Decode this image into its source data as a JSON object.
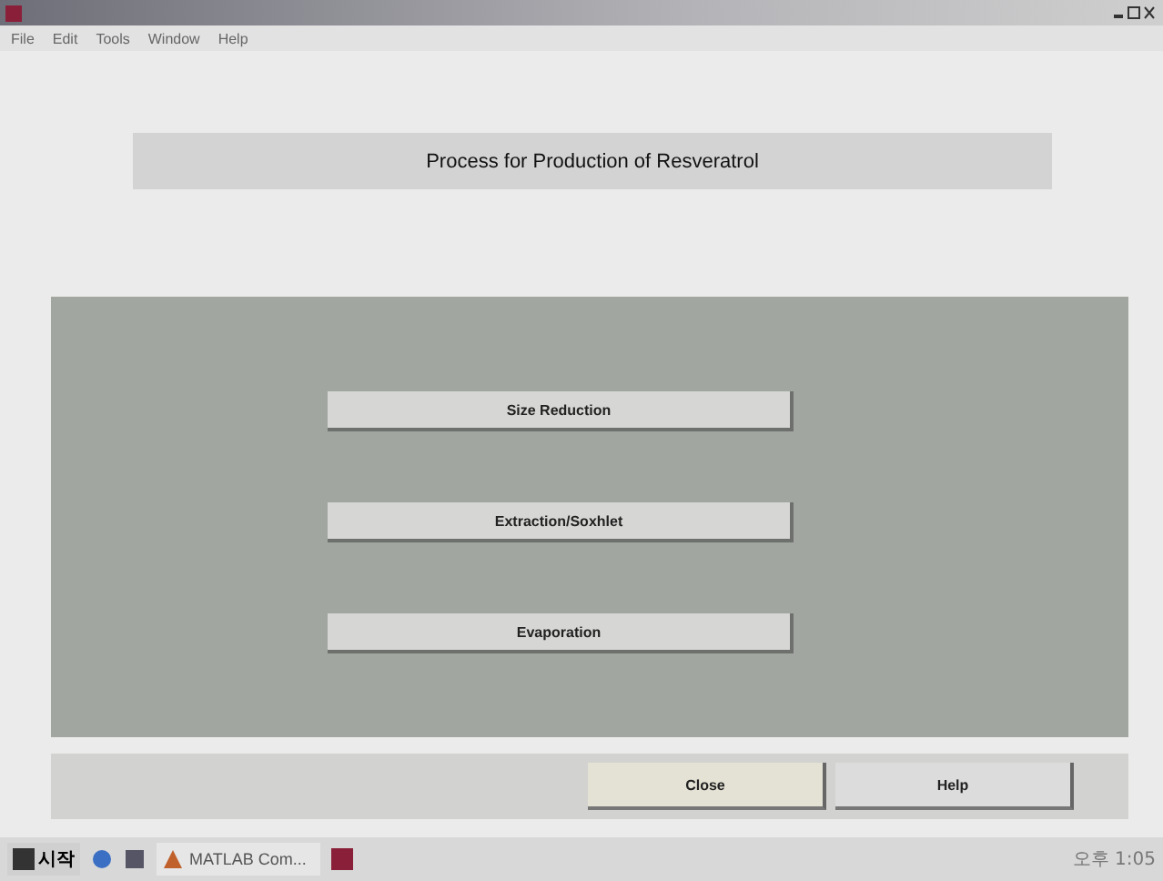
{
  "window": {
    "menu": [
      "File",
      "Edit",
      "Tools",
      "Window",
      "Help"
    ]
  },
  "header": {
    "title": "Process for Production of Resveratrol"
  },
  "steps": [
    "Size Reduction",
    "Extraction/Soxhlet",
    "Evaporation"
  ],
  "footer_buttons": [
    "Close",
    "Help"
  ],
  "taskbar": {
    "start": "시작",
    "items": [
      {
        "label": "MATLAB Com..."
      }
    ],
    "clock": "오후 1:05"
  }
}
